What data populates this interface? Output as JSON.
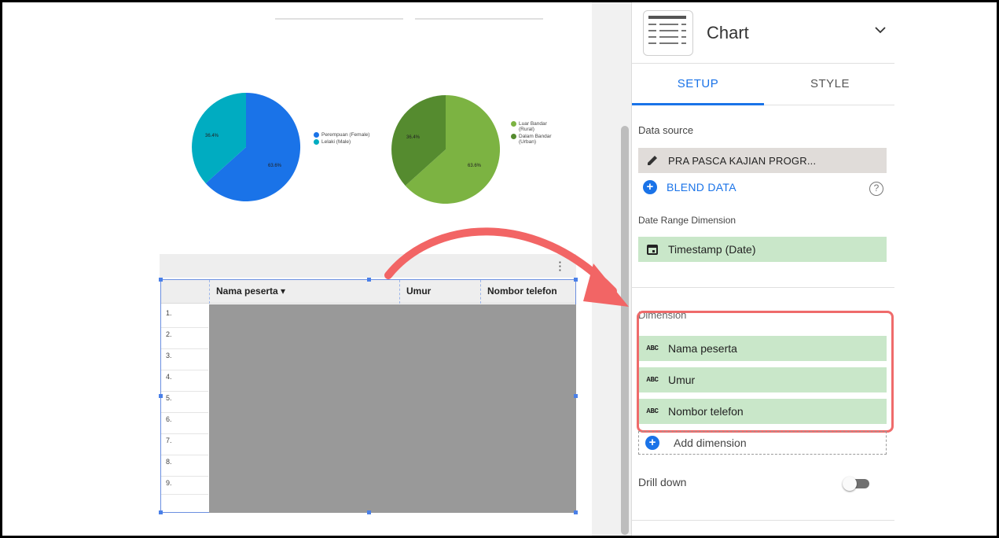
{
  "canvas": {
    "pie1": {
      "slices": [
        {
          "label": "63.6%",
          "value": 63.6,
          "color": "#1a73e8"
        },
        {
          "label": "36.4%",
          "value": 36.4,
          "color": "#00acc1"
        }
      ],
      "legend": [
        {
          "label": "Perempuan (Female)",
          "color": "#1a73e8"
        },
        {
          "label": "Lelaki (Male)",
          "color": "#00acc1"
        }
      ]
    },
    "pie2": {
      "slices": [
        {
          "label": "63.6%",
          "value": 63.6,
          "color": "#7cb342"
        },
        {
          "label": "36.4%",
          "value": 36.4,
          "color": "#558b2f"
        }
      ],
      "legend": [
        {
          "label": "Luar Bandar (Rural)",
          "color": "#7cb342"
        },
        {
          "label": "Dalam Bandar (Urban)",
          "color": "#558b2f"
        }
      ]
    },
    "table": {
      "columns": [
        "Nama peserta ▾",
        "Umur",
        "Nombor telefon"
      ],
      "rows": [
        "1.",
        "2.",
        "3.",
        "4.",
        "5.",
        "6.",
        "7.",
        "8.",
        "9."
      ],
      "menu_icon": "kebab-icon"
    }
  },
  "panel": {
    "title": "Chart",
    "chart_type_icon": "table-chart-icon",
    "tabs": [
      {
        "label": "SETUP",
        "active": true
      },
      {
        "label": "STYLE",
        "active": false
      }
    ],
    "data_source": {
      "label": "Data source",
      "value": "PRA PASCA KAJIAN PROGR...",
      "icon": "pencil-icon"
    },
    "blend_data": {
      "label": "BLEND DATA",
      "help_icon": "help-icon"
    },
    "date_range": {
      "label": "Date Range Dimension",
      "value": "Timestamp (Date)",
      "icon": "calendar-icon"
    },
    "dimension": {
      "label": "Dimension",
      "items": [
        {
          "type": "ABC",
          "label": "Nama peserta"
        },
        {
          "type": "ABC",
          "label": "Umur"
        },
        {
          "type": "ABC",
          "label": "Nombor telefon"
        }
      ],
      "add_label": "Add dimension"
    },
    "drill_down": {
      "label": "Drill down",
      "enabled": false
    }
  },
  "colors": {
    "accent": "#1a73e8",
    "highlight": "#ef6b6b",
    "dimension_bg": "#c9e7c9"
  }
}
